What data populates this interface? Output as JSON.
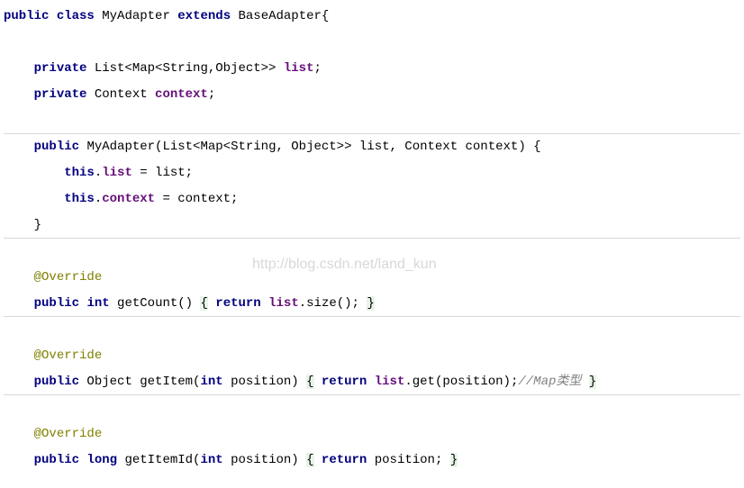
{
  "code": {
    "l1_public": "public",
    "l1_class": "class",
    "l1_name": "MyAdapter",
    "l1_extends": "extends",
    "l1_base": "BaseAdapter",
    "l1_brace": "{",
    "l3_private": "private",
    "l3_type": "List<Map<String,Object>>",
    "l3_field": "list",
    "l3_semi": ";",
    "l4_private": "private",
    "l4_type": "Context",
    "l4_field": "context",
    "l4_semi": ";",
    "l6_public": "public",
    "l6_sig": "MyAdapter(List<Map<String, Object>> list, Context context) {",
    "l7_this": "this",
    "l7_dot": ".",
    "l7_field": "list",
    "l7_rest": " = list;",
    "l8_this": "this",
    "l8_dot": ".",
    "l8_field": "context",
    "l8_rest": " = context;",
    "l9_brace": "}",
    "override": "@Override",
    "l12_public": "public",
    "l12_int": "int",
    "l12_name": " getCount()",
    "l12_ob": "{",
    "l12_return": "return",
    "l12_field": "list",
    "l12_call": ".size();",
    "l12_cb": "}",
    "l15_public": "public",
    "l15_sig1": " Object getItem(",
    "l15_int": "int",
    "l15_sig2": " position)",
    "l15_ob": "{",
    "l15_return": "return",
    "l15_field": "list",
    "l15_call": ".get(position);",
    "l15_comment": "//Map类型",
    "l15_cb": "}",
    "l18_public": "public",
    "l18_long": "long",
    "l18_sig1": " getItemId(",
    "l18_int": "int",
    "l18_sig2": " position)",
    "l18_ob": "{",
    "l18_return": "return",
    "l18_rest": " position;",
    "l18_cb": "}"
  },
  "watermark": "http://blog.csdn.net/land_kun"
}
